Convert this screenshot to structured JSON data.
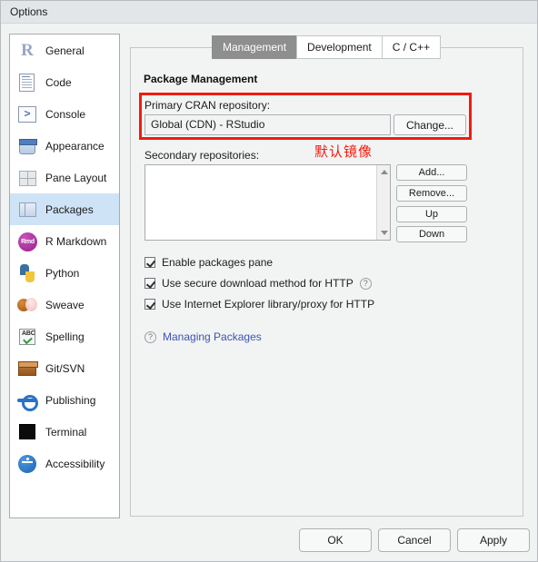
{
  "window": {
    "title": "Options"
  },
  "sidebar": {
    "items": [
      {
        "label": "General",
        "icon": "r-logo-icon",
        "selected": false
      },
      {
        "label": "Code",
        "icon": "code-document-icon",
        "selected": false
      },
      {
        "label": "Console",
        "icon": "console-prompt-icon",
        "selected": false
      },
      {
        "label": "Appearance",
        "icon": "paint-bucket-icon",
        "selected": false
      },
      {
        "label": "Pane Layout",
        "icon": "pane-grid-icon",
        "selected": false
      },
      {
        "label": "Packages",
        "icon": "package-box-icon",
        "selected": true
      },
      {
        "label": "R Markdown",
        "icon": "rmd-badge-icon",
        "selected": false
      },
      {
        "label": "Python",
        "icon": "python-logo-icon",
        "selected": false
      },
      {
        "label": "Sweave",
        "icon": "sweave-knitr-pdf-icon",
        "selected": false
      },
      {
        "label": "Spelling",
        "icon": "spellcheck-abc-icon",
        "selected": false
      },
      {
        "label": "Git/SVN",
        "icon": "package-carton-icon",
        "selected": false
      },
      {
        "label": "Publishing",
        "icon": "publish-orbit-icon",
        "selected": false
      },
      {
        "label": "Terminal",
        "icon": "terminal-black-icon",
        "selected": false
      },
      {
        "label": "Accessibility",
        "icon": "accessibility-icon",
        "selected": false
      }
    ]
  },
  "tabs": [
    {
      "label": "Management",
      "active": true
    },
    {
      "label": "Development",
      "active": false
    },
    {
      "label": "C / C++",
      "active": false
    }
  ],
  "main": {
    "section_title": "Package Management",
    "cran_label": "Primary CRAN repository:",
    "cran_value": "Global (CDN) - RStudio",
    "change_button": "Change...",
    "annotation": "默认镜像",
    "secondary_label": "Secondary repositories:",
    "secondary_items": [],
    "list_buttons": [
      "Add...",
      "Remove...",
      "Up",
      "Down"
    ],
    "checkboxes": [
      {
        "label": "Enable packages pane",
        "checked": true,
        "help": false
      },
      {
        "label": "Use secure download method for HTTP",
        "checked": true,
        "help": true
      },
      {
        "label": "Use Internet Explorer library/proxy for HTTP",
        "checked": true,
        "help": false
      }
    ],
    "help_glyph": "?",
    "link_text": "Managing Packages"
  },
  "footer": {
    "buttons": [
      "OK",
      "Cancel",
      "Apply"
    ]
  },
  "colors": {
    "annotation_red": "#f41a0e",
    "selection_blue": "#cfe3f7",
    "active_tab_gray": "#8e8e8e",
    "link_blue": "#3c52b4"
  }
}
